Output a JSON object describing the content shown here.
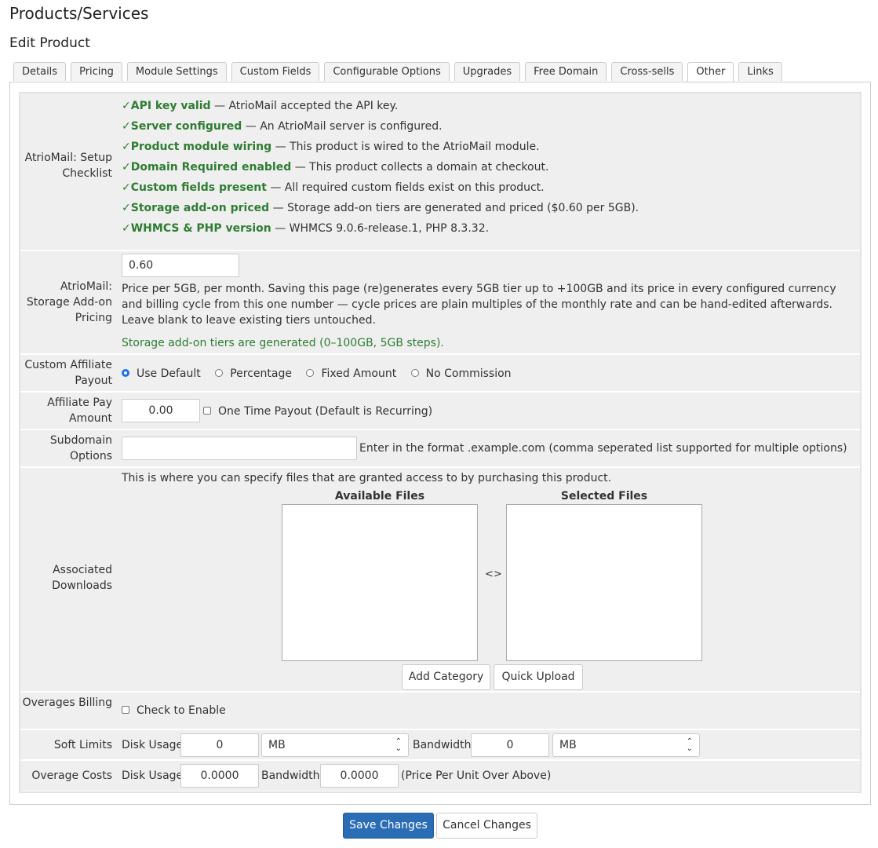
{
  "header": {
    "title": "Products/Services",
    "subtitle": "Edit Product"
  },
  "tabs": [
    {
      "label": "Details"
    },
    {
      "label": "Pricing"
    },
    {
      "label": "Module Settings"
    },
    {
      "label": "Custom Fields"
    },
    {
      "label": "Configurable Options"
    },
    {
      "label": "Upgrades"
    },
    {
      "label": "Free Domain"
    },
    {
      "label": "Cross-sells"
    },
    {
      "label": "Other",
      "active": true
    },
    {
      "label": "Links"
    }
  ],
  "checklist": {
    "label": "AtrioMail: Setup Checklist",
    "tick": "✓",
    "items": [
      {
        "name": "API key valid",
        "desc": " — AtrioMail accepted the API key."
      },
      {
        "name": "Server configured",
        "desc": " — An AtrioMail server is configured."
      },
      {
        "name": "Product module wiring",
        "desc": " — This product is wired to the AtrioMail module."
      },
      {
        "name": "Domain Required enabled",
        "desc": " — This product collects a domain at checkout."
      },
      {
        "name": "Custom fields present",
        "desc": " — All required custom fields exist on this product."
      },
      {
        "name": "Storage add-on priced",
        "desc": " — Storage add-on tiers are generated and priced ($0.60 per 5GB)."
      },
      {
        "name": "WHMCS & PHP version",
        "desc": " — WHMCS 9.0.6-release.1, PHP 8.3.32."
      }
    ]
  },
  "storage": {
    "label": "AtrioMail: Storage Add-on Pricing",
    "value": "0.60",
    "help": "Price per 5GB, per month. Saving this page (re)generates every 5GB tier up to +100GB and its price in every configured currency and billing cycle from this one number — cycle prices are plain multiples of the monthly rate and can be hand-edited afterwards. Leave blank to leave existing tiers untouched.",
    "status": "Storage add-on tiers are generated (0–100GB, 5GB steps)."
  },
  "affiliate": {
    "label": "Custom Affiliate Payout",
    "options": [
      "Use Default",
      "Percentage",
      "Fixed Amount",
      "No Commission"
    ],
    "selected": "Use Default"
  },
  "pay_amount": {
    "label": "Affiliate Pay Amount",
    "value": "0.00",
    "one_time_label": "One Time Payout (Default is Recurring)"
  },
  "subdomain": {
    "label": "Subdomain Options",
    "value": "",
    "help": "Enter in the format .example.com (comma seperated list supported for multiple options)"
  },
  "downloads": {
    "label": "Associated Downloads",
    "intro": "This is where you can specify files that are granted access to by purchasing this product.",
    "available_header": "Available Files",
    "selected_header": "Selected Files",
    "swap": "<>",
    "add_category": "Add Category",
    "quick_upload": "Quick Upload"
  },
  "overages": {
    "label": "Overages Billing",
    "check_label": "Check to Enable"
  },
  "soft_limits": {
    "label": "Soft Limits",
    "disk_label": "Disk Usage",
    "disk_value": "0",
    "disk_unit": "MB",
    "bw_label": "Bandwidth",
    "bw_value": "0",
    "bw_unit": "MB"
  },
  "overage_costs": {
    "label": "Overage Costs",
    "disk_label": "Disk Usage",
    "disk_value": "0.0000",
    "bw_label": "Bandwidth",
    "bw_value": "0.0000",
    "note": "(Price Per Unit Over Above)"
  },
  "actions": {
    "save": "Save Changes",
    "cancel": "Cancel Changes"
  }
}
